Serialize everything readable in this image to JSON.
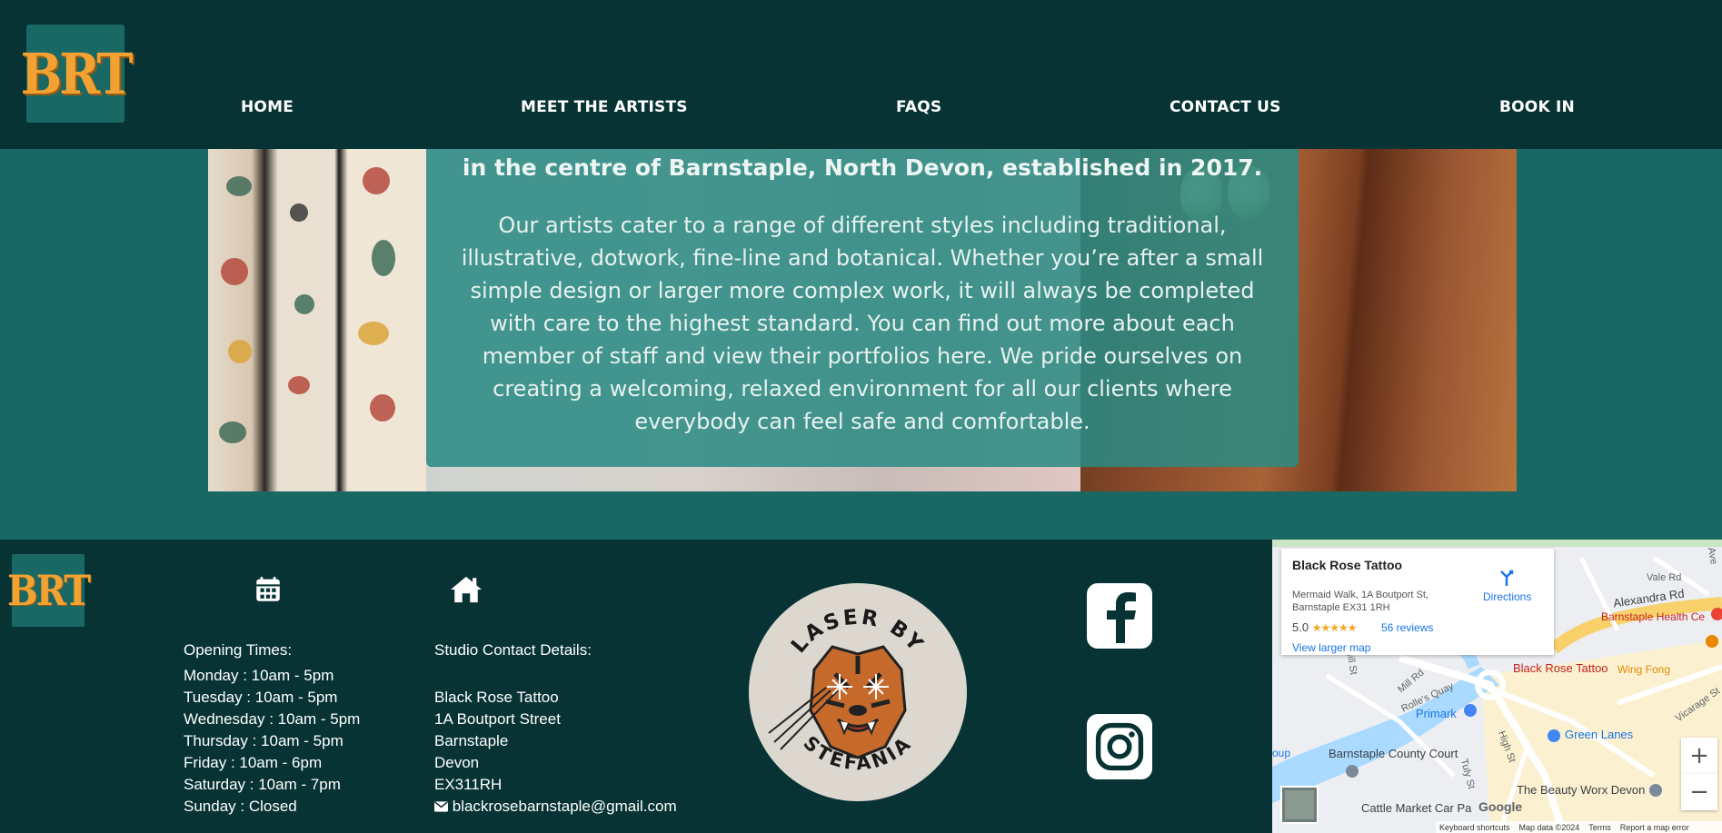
{
  "header": {
    "logo_text": "BRT",
    "nav": [
      {
        "label": "HOME"
      },
      {
        "label": "MEET THE ARTISTS"
      },
      {
        "label": "FAQS"
      },
      {
        "label": "CONTACT US"
      },
      {
        "label": "BOOK IN"
      }
    ]
  },
  "hero": {
    "title_line": "in the centre of Barnstaple, North Devon, established in 2017.",
    "body": "Our artists cater to a range of different styles including traditional, illustrative, dotwork, fine-line and botanical. Whether you’re after a small simple design or larger more complex work, it will always be completed with care to the highest standard. You can find out more about each member of staff and view their portfolios here. We pride ourselves on creating a welcoming, relaxed environment for all our clients where everybody can feel safe and comfortable."
  },
  "footer": {
    "logo_text": "BRT",
    "opening": {
      "icon": "calendar-icon",
      "heading": "Opening Times:",
      "days": [
        "Monday : 10am - 5pm",
        "Tuesday : 10am - 5pm",
        "Wednesday : 10am - 5pm",
        "Thursday : 10am - 5pm",
        "Friday : 10am - 6pm",
        "Saturday : 10am - 7pm",
        "Sunday : Closed"
      ]
    },
    "contact": {
      "icon": "home-icon",
      "heading": "Studio Contact Details:",
      "lines": [
        "Black Rose Tattoo",
        "1A Boutport Street",
        "Barnstaple",
        "Devon",
        "EX311RH"
      ],
      "email": "blackrosebarnstaple@gmail.com"
    },
    "badge": {
      "top_text": "LASER BY",
      "bottom_text": "STEFANIA"
    },
    "social": [
      "facebook-icon",
      "instagram-icon"
    ]
  },
  "map": {
    "card": {
      "title": "Black Rose Tattoo",
      "address": "Mermaid Walk, 1A Boutport St, Barnstaple EX31 1RH",
      "rating": "5.0",
      "stars": "★★★★★",
      "reviews": "56 reviews",
      "directions": "Directions",
      "larger": "View larger map"
    },
    "labels": {
      "pin": "Black Rose Tattoo",
      "alexandra": "Alexandra Rd",
      "health": "Barnstaple Health Ce",
      "wingfong": "Wing Fong",
      "greenlanes": "Green Lanes",
      "primark": "Primark",
      "court": "Barnstaple County Court",
      "beauty": "The Beauty Worx Devon",
      "cattle": "Cattle Market Car Pa",
      "valerd": "Vale Rd",
      "millrd": "Mill Rd",
      "rollesquay": "Rolle's Quay",
      "highst": "High St",
      "tulyst": "Tuly St",
      "vicarage": "Vicarage St",
      "oup": "oup",
      "ave": "Ave",
      "millst": "Mill St"
    },
    "footer": {
      "shortcuts": "Keyboard shortcuts",
      "data": "Map data ©2024",
      "terms": "Terms",
      "report": "Report a map error",
      "google": "Google"
    },
    "zoom_in": "+",
    "zoom_out": "−"
  }
}
